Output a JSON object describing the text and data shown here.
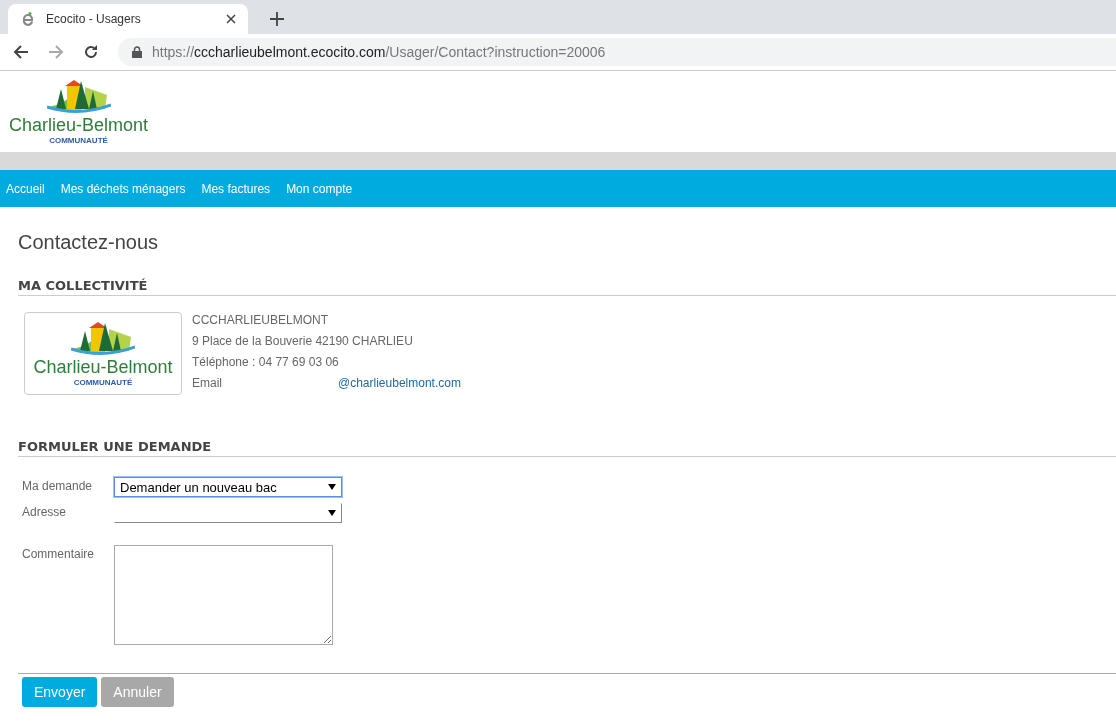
{
  "browser": {
    "tab_title": "Ecocito - Usagers",
    "url_scheme": "https://",
    "url_host": "cccharlieubelmont.ecocito.com",
    "url_path": "/Usager/Contact?instruction=20006"
  },
  "header": {
    "logo_name": "Charlieu-Belmont",
    "logo_subtitle": "COMMUNAUTÉ"
  },
  "nav": {
    "items": [
      "Accueil",
      "Mes déchets ménagers",
      "Mes factures",
      "Mon compte"
    ]
  },
  "page_title": "Contactez-nous",
  "collectivity": {
    "heading": "MA COLLECTIVITÉ",
    "logo_name": "Charlieu-Belmont",
    "logo_subtitle": "COMMUNAUTÉ",
    "name": "CCCHARLIEUBELMONT",
    "address": "9 Place de la Bouverie 42190 CHARLIEU",
    "phone": "Téléphone : 04 77 69 03 06",
    "email_label": "Email",
    "email": "@charlieubelmont.com"
  },
  "form": {
    "heading": "FORMULER UNE DEMANDE",
    "fields": [
      {
        "kind": "select",
        "label": "Ma demande",
        "value": "Demander un nouveau bac",
        "focused": true
      },
      {
        "kind": "select",
        "label": "Adresse",
        "focused": false
      },
      {
        "kind": "textarea",
        "label": "Commentaire",
        "focused": false
      }
    ],
    "buttons": [
      {
        "label": "Envoyer",
        "kind": "primary"
      },
      {
        "label": "Annuler",
        "kind": "secondary"
      }
    ]
  }
}
